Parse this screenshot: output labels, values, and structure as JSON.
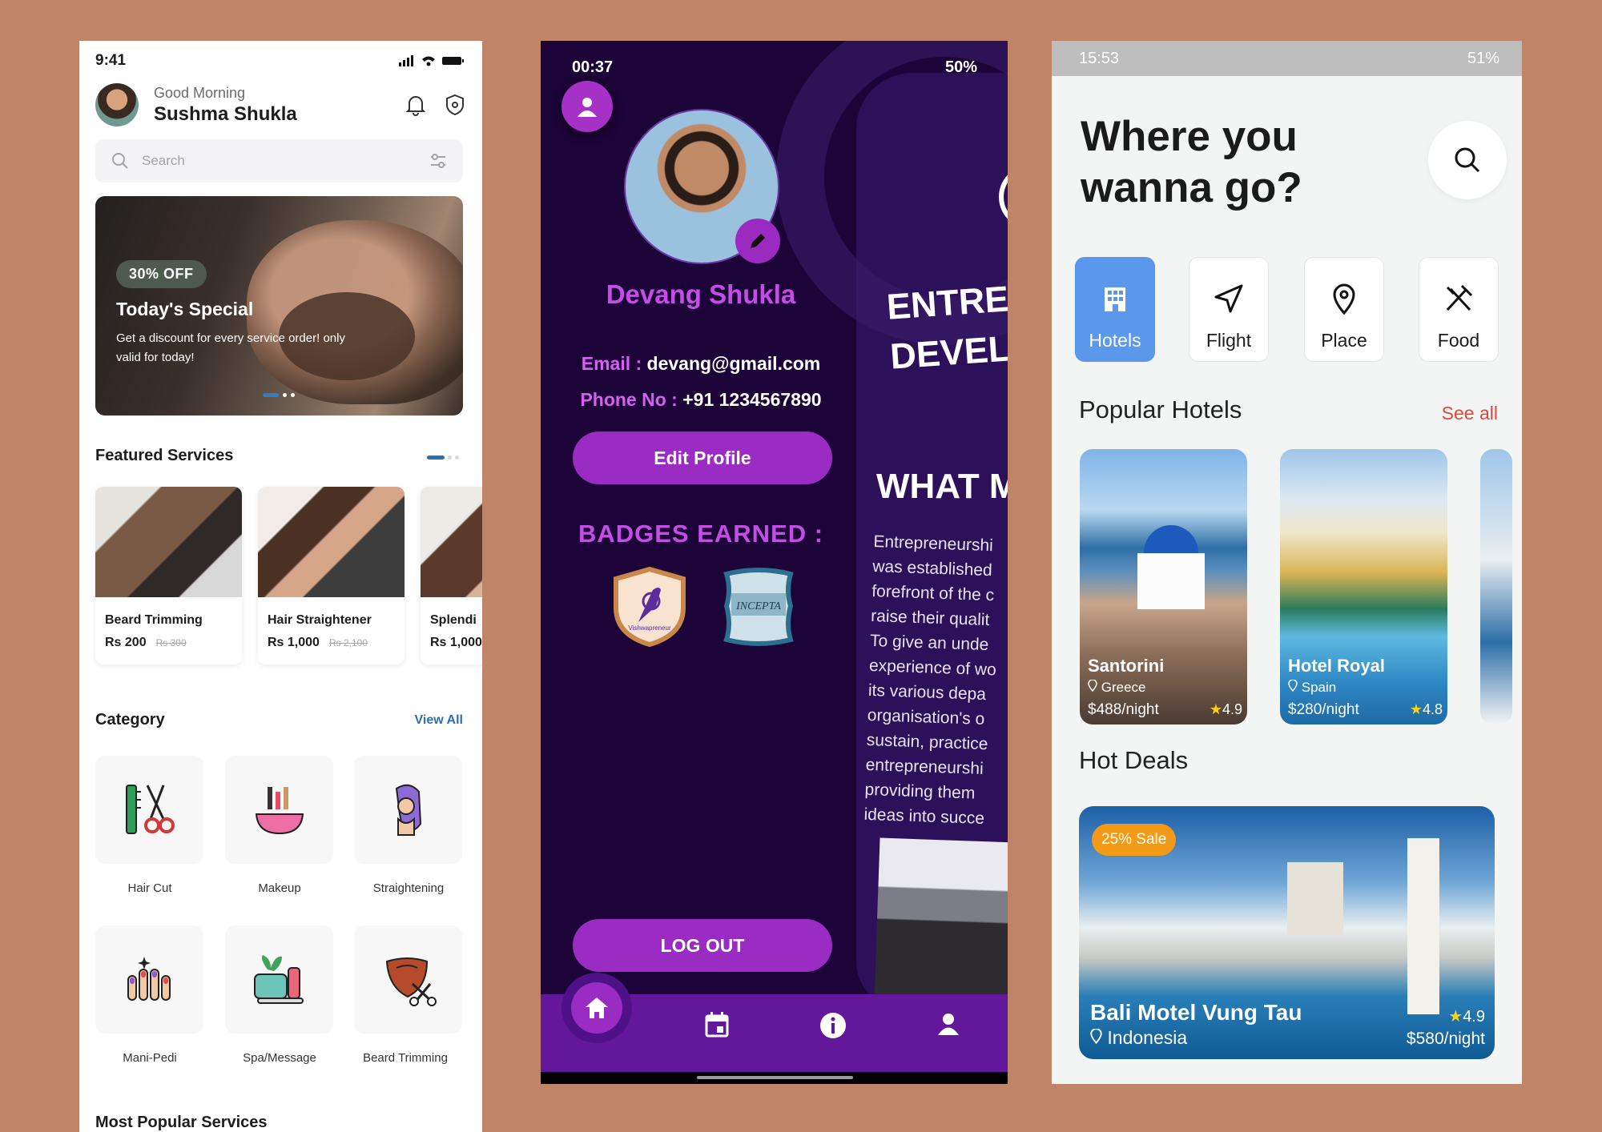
{
  "phone1": {
    "status_time": "9:41",
    "greeting": "Good Morning",
    "user_name": "Sushma Shukla",
    "search_placeholder": "Search",
    "banner": {
      "badge": "30% OFF",
      "title": "Today's Special",
      "desc": "Get a discount for every service order! only valid for today!"
    },
    "featured_title": "Featured Services",
    "services": [
      {
        "name": "Beard Trimming",
        "price": "Rs 200",
        "old_price": "Rs 300"
      },
      {
        "name": "Hair Straightener",
        "price": "Rs 1,000",
        "old_price": "Rs 2,100"
      },
      {
        "name": "Splendi",
        "price": "Rs 1,000"
      }
    ],
    "category_title": "Category",
    "view_all": "View All",
    "categories": [
      "Hair Cut",
      "Makeup",
      "Straightening",
      "Mani-Pedi",
      "Spa/Message",
      "Beard Trimming"
    ],
    "popular_title": "Most Popular Services"
  },
  "phone2": {
    "status_time": "00:37",
    "battery": "50%",
    "name": "Devang Shukla",
    "email_label": "Email :",
    "email": "devang@gmail.com",
    "phone_label": "Phone No :",
    "phone": "+91 1234567890",
    "edit_profile": "Edit Profile",
    "badges_title": "BADGES EARNED :",
    "badges": [
      "Vishwapreneur",
      "INCEPTA"
    ],
    "logout": "LOG OUT",
    "panel": {
      "heading_1": "ENTREF",
      "heading_2": "DEVELO",
      "what": "WHAT M",
      "para": [
        "Entrepreneurshi",
        "was established",
        "forefront of the c",
        "raise their qualit",
        "To give an unde",
        "experience of wo",
        "its various depa",
        "organisation's o",
        "sustain, practice",
        "entrepreneurshi",
        "providing them",
        "ideas into succe"
      ]
    }
  },
  "phone3": {
    "status_time": "15:53",
    "battery": "51%",
    "headline_1": "Where you",
    "headline_2": "wanna go?",
    "categories": [
      "Hotels",
      "Flight",
      "Place",
      "Food"
    ],
    "popular_title": "Popular Hotels",
    "see_all": "See all",
    "hotels": [
      {
        "name": "Santorini",
        "location": "Greece",
        "price": "$488/night",
        "rating": "4.9"
      },
      {
        "name": "Hotel Royal",
        "location": "Spain",
        "price": "$280/night",
        "rating": "4.8"
      }
    ],
    "hot_deals_title": "Hot Deals",
    "deal": {
      "badge": "25% Sale",
      "name": "Bali Motel Vung Tau",
      "location": "Indonesia",
      "price": "$580/night",
      "rating": "4.9"
    }
  },
  "colors": {
    "background": "#c08468",
    "p2_accent": "#9a2cc4",
    "p3_accent": "#5b97ea",
    "see_all": "#e2473a"
  }
}
